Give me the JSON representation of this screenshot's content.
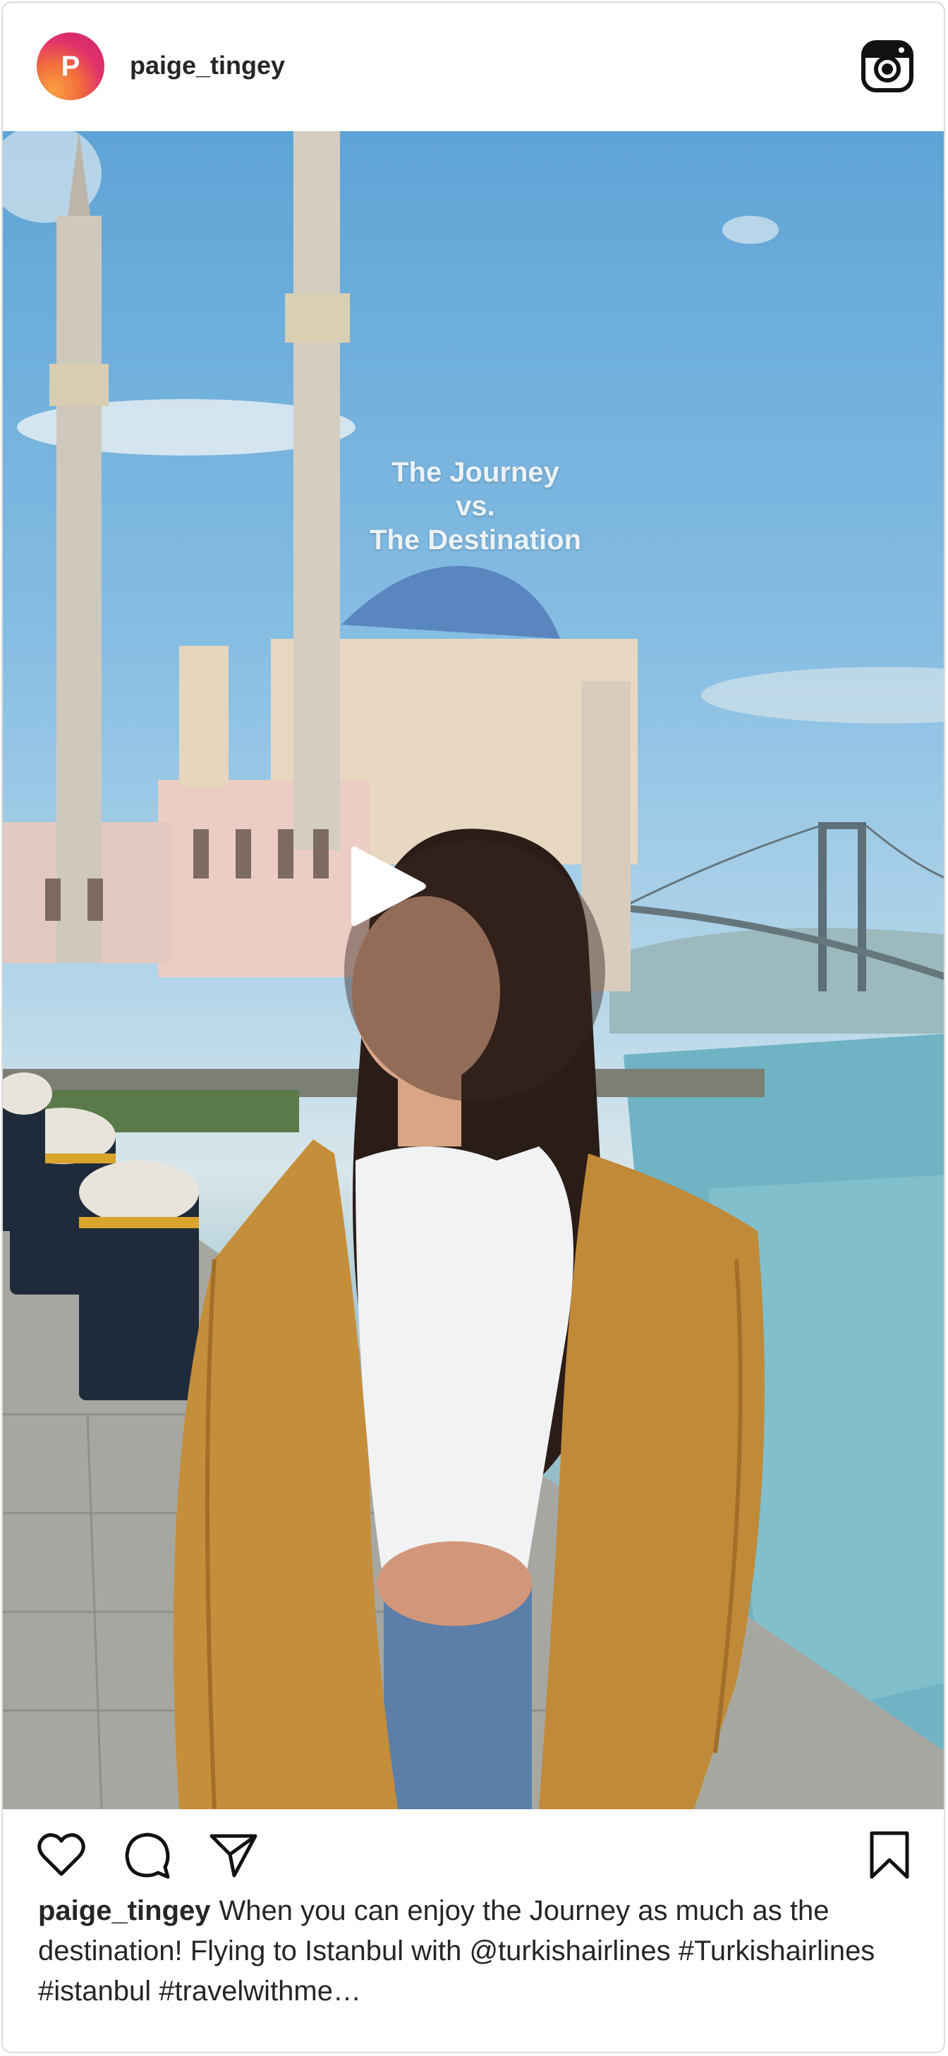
{
  "header": {
    "avatar_letter": "P",
    "username": "paige_tingey"
  },
  "media": {
    "overlay_lines": [
      "The Journey",
      "vs.",
      "The Destination"
    ],
    "type": "video"
  },
  "caption": {
    "username": "paige_tingey",
    "text": "When you can enjoy the Journey as much as the destination! Flying to Istanbul with @turkishairlines #Turkishairlines #istanbul #travelwithme…"
  },
  "icons": {
    "brand": "instagram-icon",
    "like": "heart-icon",
    "comment": "comment-icon",
    "share": "paper-plane-icon",
    "save": "bookmark-icon",
    "play": "play-icon"
  },
  "colors": {
    "avatar_gradient": [
      "#f9a03f",
      "#e1306c"
    ],
    "text": "#262626",
    "border": "#dcdcdc"
  }
}
